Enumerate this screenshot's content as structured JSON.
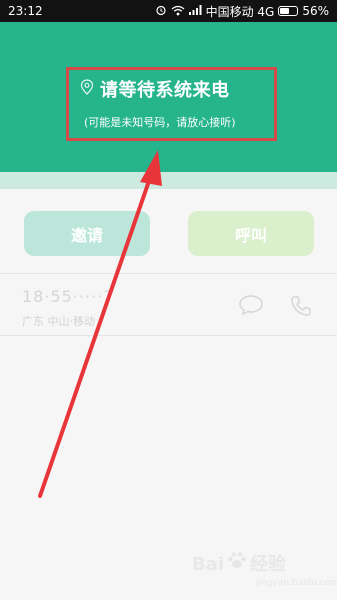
{
  "status_bar": {
    "time": "23:12",
    "carrier": "中国移动 4G",
    "battery": "56%",
    "battery_level": 0.56,
    "icons": [
      "alarm-icon",
      "wifi-icon",
      "signal-icon",
      "battery-icon"
    ]
  },
  "header": {
    "title": "请等待系统来电",
    "subtitle": "(可能是未知号码，请放心接听)",
    "icon": "location-pin-icon"
  },
  "actions": {
    "invite_label": "邀请",
    "call_label": "呼叫"
  },
  "contact": {
    "phone": "18·55·····7",
    "location": "广东 中山·移动",
    "icons": [
      "chat-bubble-icon",
      "phone-icon"
    ]
  },
  "watermark": {
    "brand": "Bai",
    "suffix": "经验",
    "url": "jingyan.baidu.com"
  },
  "colors": {
    "header": "#25b48c",
    "invite_button": "#bde6db",
    "call_button": "#daefcb",
    "highlight": "#d84a4a",
    "arrow": "#e8353a"
  }
}
